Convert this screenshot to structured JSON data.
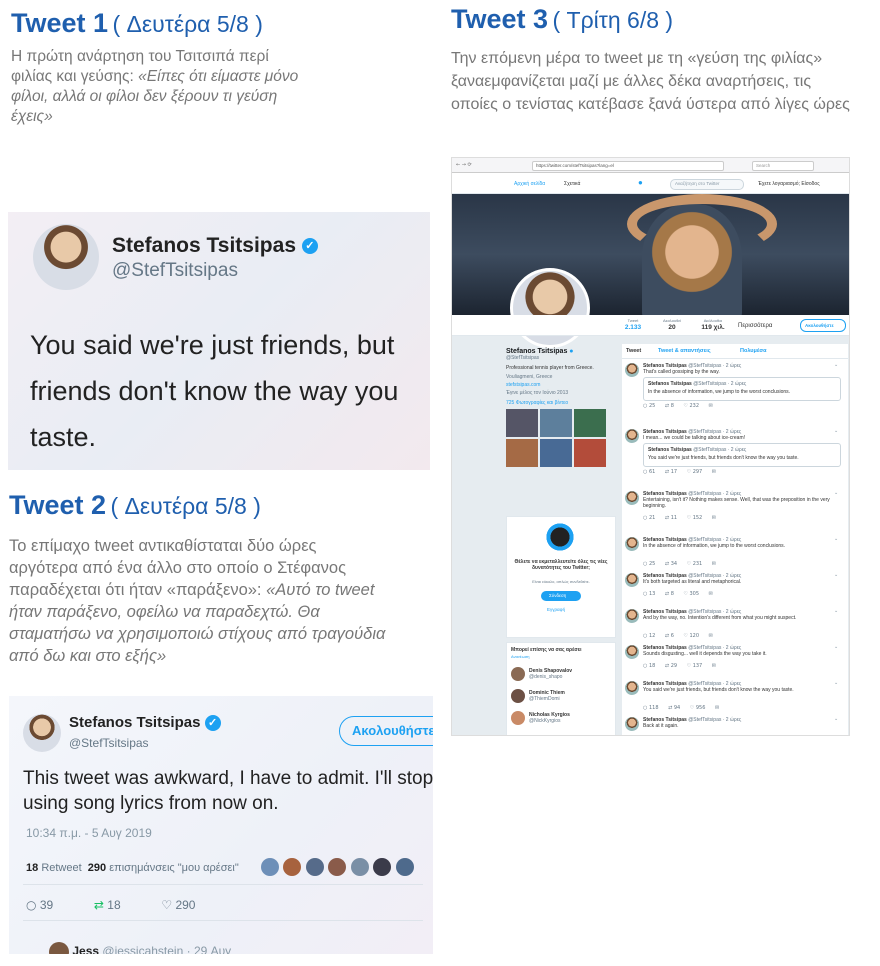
{
  "tweet1": {
    "heading": "Tweet 1",
    "date": "( Δευτέρα 5/8 )",
    "intro": "Η πρώτη ανάρτηση του Τσιτσιπά περί φιλίας και γεύσης: ",
    "quote": "«Είπες ότι είμαστε μόνο φίλοι, αλλά οι φίλοι δεν ξέρουν τι γεύση έχεις»",
    "card": {
      "name": "Stefanos Tsitsipas",
      "handle": "@StefTsitsipas",
      "text": "You said we're just friends, but friends don't know the way you taste."
    }
  },
  "tweet2": {
    "heading": "Tweet 2",
    "date": "( Δευτέρα 5/8 )",
    "intro": "Το επίμαχο tweet αντικαθίσταται δύο ώρες αργότερα από ένα άλλο στο οποίο ο Στέφανος παραδέχεται ότι ήταν «παράξενο»: ",
    "quote": "«Αυτό το tweet ήταν παράξενο, οφείλω να παραδεχτώ. Θα σταματήσω να χρησιμοποιώ στίχους από τραγούδια από δω και στο εξής»",
    "card": {
      "name": "Stefanos Tsitsipas",
      "handle": "@StefTsitsipas",
      "follow_label": "Ακολουθήστε",
      "text": "This tweet was awkward, I have to admit. I'll stop using song lyrics from now on.",
      "time": "10:34 π.μ. - 5 Αυγ 2019",
      "retweet_count": "18",
      "retweet_label": "Retweet",
      "likes_count": "290",
      "likes_label": "επισημάνσεις \"μου αρέσει\"",
      "reply_count": "39",
      "rt_count": "18",
      "like_count": "290",
      "next_user": "Jess",
      "next_handle": "@jessicahstein · 29 Αυγ"
    }
  },
  "tweet3": {
    "heading": "Tweet 3",
    "date": "( Τρίτη 6/8 )",
    "intro": "Την επόμενη μέρα το tweet με τη «γεύση της φιλίας» ξαναεμφανίζεται μαζί με άλλες δέκα αναρτήσεις, τις οποίες ο τενίστας κατέβασε ξανά ύστερα από λίγες ώρες",
    "browser": {
      "url": "https://twitter.com/stefTsitsipas?lang=el",
      "search": "Search",
      "nav_home": "Αρχική σελίδα",
      "nav_about": "Σχετικά",
      "search_twitter": "Αναζήτηση στο Twitter",
      "account": "Έχετε λογαριασμό; Είσοδος"
    },
    "profile": {
      "stats": [
        {
          "label": "Tweet",
          "value": "2.133"
        },
        {
          "label": "Ακολουθεί",
          "value": "20"
        },
        {
          "label": "Ακόλουθοι",
          "value": "119 χιλ."
        }
      ],
      "more": "Περισσότερα",
      "follow": "Ακολουθήστε",
      "name": "Stefanos Tsitsipas",
      "handle": "@StefTsitsipas",
      "bio": "Professional tennis player from Greece.",
      "location": "Vouliagmeni, Greece",
      "site": "stefstsipas.com",
      "joined": "Έγινε μέλος τον Ιούνιο 2013",
      "photos": "725 Φωτογραφίες και βίντεο",
      "tabs": [
        "Tweet",
        "Tweet & απαντήσεις",
        "Πολυμέσα"
      ]
    },
    "signup": {
      "title": "Θέλετε να εκμεταλλευτείτε όλες τις νέες δυνατότητες του Twitter;",
      "sub": "Είναι εύκολο, απλώς συνδεθείτε.",
      "login": "Σύνδεση",
      "register": "Εγγραφή"
    },
    "suggest": {
      "title": "Μπορεί επίσης να σας αρέσει",
      "refresh": "Ανανέωση",
      "users": [
        {
          "name": "Denis Shapovalov",
          "handle": "@denis_shapo"
        },
        {
          "name": "Dominic Thiem",
          "handle": "@ThiemDomi"
        },
        {
          "name": "Nicholas Kyrgios",
          "handle": "@NickKyrgios"
        }
      ]
    },
    "feed": [
      {
        "text": "That's called gossiping by the way.",
        "quote": "In the absence of information, we jump to the worst conclusions.",
        "r": "25",
        "t": "8",
        "l": "232"
      },
      {
        "text": "I mean... we could be talking about ice-cream!",
        "quote": "You said we're just friends, but friends don't know the way you taste.",
        "r": "61",
        "t": "17",
        "l": "297"
      },
      {
        "text": "Entertaining, isn't it? Nothing makes sense. Well, that was the preposition in the very beginning.",
        "quote": "",
        "r": "21",
        "t": "11",
        "l": "152"
      },
      {
        "text": "In the absence of information, we jump to the worst conclusions.",
        "quote": "",
        "r": "25",
        "t": "34",
        "l": "231"
      },
      {
        "text": "It's both targeted as literal and metaphorical.",
        "quote": "",
        "r": "13",
        "t": "8",
        "l": "305"
      },
      {
        "text": "And by the way, no. Intention's different from what you might suspect.",
        "quote": "",
        "r": "12",
        "t": "6",
        "l": "120"
      },
      {
        "text": "Sounds disgusting... well it depends the way you take it.",
        "quote": "",
        "r": "18",
        "t": "29",
        "l": "137"
      },
      {
        "text": "You said we're just friends, but friends don't know the way you taste.",
        "quote": "",
        "r": "118",
        "t": "94",
        "l": "956"
      },
      {
        "text": "Back at it again.",
        "quote": "",
        "r": "",
        "t": "",
        "l": ""
      }
    ],
    "tweet_author": "Stefanos Tsitsipas",
    "tweet_meta": "@StefTsitsipas · 2 ώρες"
  }
}
